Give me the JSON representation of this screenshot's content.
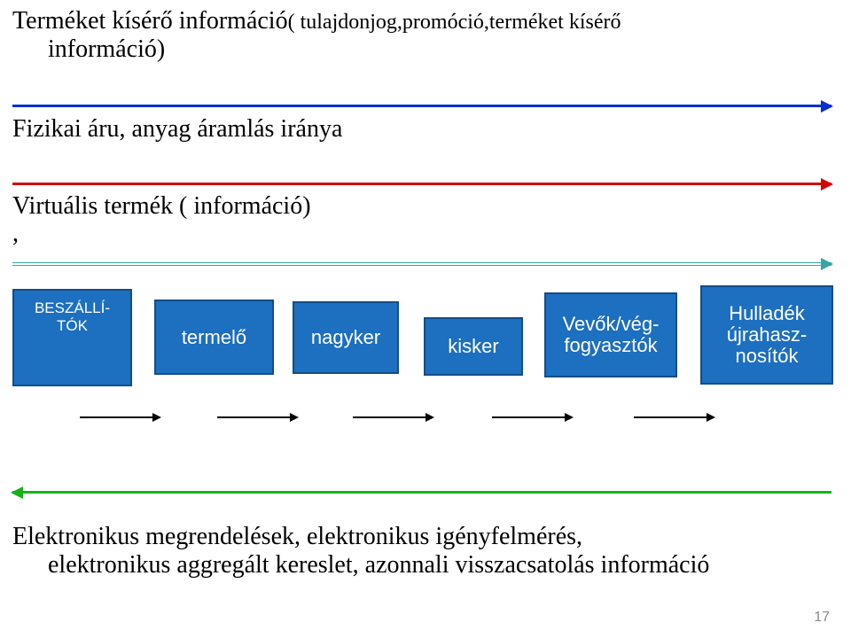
{
  "title": {
    "main": "Terméket kísérő információ",
    "sub": "( tulajdonjog,promóció,terméket kísérő",
    "sub2": "információ)"
  },
  "labels": {
    "physical": "Fizikai áru, anyag áramlás iránya",
    "virtual_line1": "Virtuális termék ( információ)",
    "virtual_line2": ","
  },
  "boxes": {
    "b1": "BESZÁLLÍ-TÓK",
    "b2": "termelő",
    "b3": "nagyker",
    "b4": "kisker",
    "b5": "Vevők/vég-fogyasztók",
    "b6": "Hulladék újrahasz-nosítók"
  },
  "bottom": {
    "l1": "Elektronikus megrendelések, elektronikus igényfelmérés,",
    "l2": "elektronikus aggregált kereslet, azonnali visszacsatolás információ"
  },
  "page": "17"
}
